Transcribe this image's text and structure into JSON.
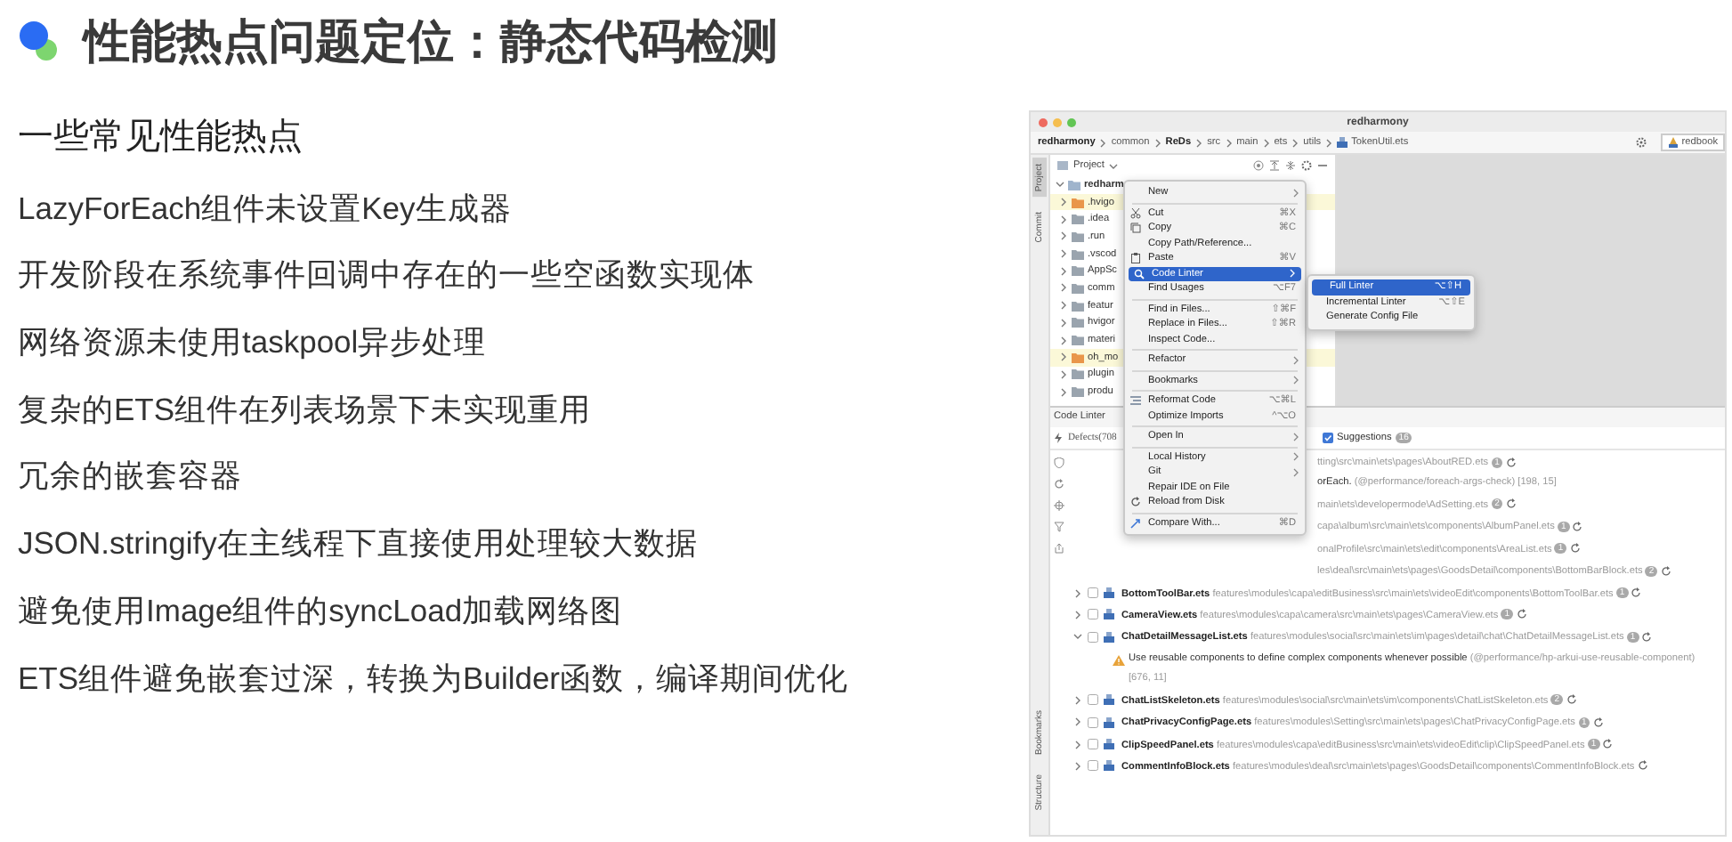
{
  "slide": {
    "title": "性能热点问题定位：静态代码检测",
    "subtitle": "一些常见性能热点",
    "points": [
      "LazyForEach组件未设置Key生成器",
      "开发阶段在系统事件回调中存在的一些空函数实现体",
      "网络资源未使用taskpool异步处理",
      "复杂的ETS组件在列表场景下未实现重用",
      "冗余的嵌套容器",
      "JSON.stringify在主线程下直接使用处理较大数据",
      "避免使用Image组件的syncLoad加载网络图",
      "ETS组件避免嵌套过深，转换为Builder函数，编译期间优化"
    ]
  },
  "ide": {
    "window_title": "redharmony",
    "breadcrumb": [
      {
        "label": "redharmony",
        "bold": true,
        "kind": "folder"
      },
      {
        "label": "common",
        "bold": false,
        "kind": "folder"
      },
      {
        "label": "ReDs",
        "bold": true,
        "kind": "folder"
      },
      {
        "label": "src",
        "bold": false,
        "kind": "folder"
      },
      {
        "label": "main",
        "bold": false,
        "kind": "folder"
      },
      {
        "label": "ets",
        "bold": false,
        "kind": "folder"
      },
      {
        "label": "utils",
        "bold": false,
        "kind": "folder"
      },
      {
        "label": "TokenUtil.ets",
        "bold": false,
        "kind": "file"
      }
    ],
    "run_config": "redbook",
    "tool_stripe": {
      "top": [
        {
          "label": "Project",
          "selected": true
        },
        {
          "label": "Commit",
          "selected": false
        }
      ],
      "bottom": [
        {
          "label": "Bookmarks",
          "selected": false
        },
        {
          "label": "Structure",
          "selected": false
        }
      ]
    },
    "project": {
      "title": "Project",
      "tree": [
        {
          "label": "redharm",
          "kind": "module",
          "expanded": true,
          "children": [
            {
              "label": ".hvigo",
              "kind": "excluded",
              "expanded": false
            },
            {
              "label": ".idea",
              "kind": "folder",
              "expanded": false
            },
            {
              "label": ".run",
              "kind": "folder",
              "expanded": false
            },
            {
              "label": ".vscod",
              "kind": "folder",
              "expanded": false
            },
            {
              "label": "AppSc",
              "kind": "folder",
              "expanded": false
            },
            {
              "label": "comm",
              "kind": "folder",
              "expanded": false
            },
            {
              "label": "featur",
              "kind": "folder",
              "expanded": false
            },
            {
              "label": "hvigor",
              "kind": "folder",
              "expanded": false
            },
            {
              "label": "materi",
              "kind": "folder",
              "expanded": false
            },
            {
              "label": "oh_mo",
              "kind": "excluded",
              "expanded": false
            },
            {
              "label": "plugin",
              "kind": "folder",
              "expanded": false
            },
            {
              "label": "produ",
              "kind": "folder",
              "expanded": false
            }
          ]
        }
      ]
    },
    "linter": {
      "title": "Code Linter",
      "defects": "Defects(708",
      "suggestions": {
        "label": "Suggestions",
        "count": "16",
        "checked": true
      },
      "rows": [
        {
          "kind": "covered-file",
          "path": "tting\\src\\main\\ets\\pages\\AboutRED.ets",
          "count": "1"
        },
        {
          "kind": "covered-issue",
          "message": "orEach.",
          "rule": "(@performance/foreach-args-check) [198, 15]"
        },
        {
          "kind": "covered-file",
          "path": "main\\ets\\developermode\\AdSetting.ets",
          "count": "2"
        },
        {
          "kind": "covered-file",
          "path": "capa\\album\\src\\main\\ets\\components\\AlbumPanel.ets",
          "count": "1"
        },
        {
          "kind": "covered-file",
          "path": "onalProfile\\src\\main\\ets\\edit\\components\\AreaList.ets",
          "count": "1"
        },
        {
          "kind": "covered-file",
          "path": "les\\deal\\src\\main\\ets\\pages\\GoodsDetail\\components\\BottomBarBlock.ets",
          "count": "2"
        },
        {
          "kind": "file",
          "expanded": false,
          "checked": false,
          "name": "BottomToolBar.ets",
          "path": "features\\modules\\capa\\editBusiness\\src\\main\\ets\\videoEdit\\components\\BottomToolBar.ets",
          "count": "1"
        },
        {
          "kind": "file",
          "expanded": false,
          "checked": false,
          "name": "CameraView.ets",
          "path": "features\\modules\\capa\\camera\\src\\main\\ets\\pages\\CameraView.ets",
          "count": "1"
        },
        {
          "kind": "file",
          "expanded": true,
          "checked": false,
          "name": "ChatDetailMessageList.ets",
          "path": "features\\modules\\social\\src\\main\\ets\\im\\pages\\detail\\chat\\ChatDetailMessageList.ets",
          "count": "1"
        },
        {
          "kind": "issue",
          "message": "Use reusable components to define complex components whenever possible",
          "rule": "(@performance/hp-arkui-use-reusable-component) [676, 11]"
        },
        {
          "kind": "file",
          "expanded": false,
          "checked": false,
          "name": "ChatListSkeleton.ets",
          "path": "features\\modules\\social\\src\\main\\ets\\im\\components\\ChatListSkeleton.ets",
          "count": "2"
        },
        {
          "kind": "file",
          "expanded": false,
          "checked": false,
          "name": "ChatPrivacyConfigPage.ets",
          "path": "features\\modules\\Setting\\src\\main\\ets\\pages\\ChatPrivacyConfigPage.ets",
          "count": "1"
        },
        {
          "kind": "file",
          "expanded": false,
          "checked": false,
          "name": "ClipSpeedPanel.ets",
          "path": "features\\modules\\capa\\editBusiness\\src\\main\\ets\\videoEdit\\clip\\ClipSpeedPanel.ets",
          "count": "1"
        },
        {
          "kind": "file",
          "expanded": false,
          "checked": false,
          "name": "CommentInfoBlock.ets",
          "path": "features\\modules\\deal\\src\\main\\ets\\pages\\GoodsDetail\\components\\CommentInfoBlock.ets"
        }
      ]
    },
    "menu": {
      "items": [
        {
          "kind": "plain",
          "label": "New",
          "submenu": true,
          "selected": false
        },
        {
          "kind": "separator"
        },
        {
          "kind": "cut",
          "label": "Cut",
          "shortcut": "⌘X",
          "submenu": false,
          "selected": false
        },
        {
          "kind": "copy",
          "label": "Copy",
          "shortcut": "⌘C",
          "submenu": false,
          "selected": false
        },
        {
          "kind": "plain",
          "label": "Copy Path/Reference...",
          "submenu": false,
          "selected": false
        },
        {
          "kind": "paste",
          "label": "Paste",
          "shortcut": "⌘V",
          "submenu": false,
          "selected": false
        },
        {
          "kind": "linter",
          "label": "Code Linter",
          "submenu": true,
          "selected": true
        },
        {
          "kind": "plain",
          "label": "Find Usages",
          "shortcut": "⌥F7",
          "submenu": false,
          "selected": false
        },
        {
          "kind": "separator"
        },
        {
          "kind": "plain",
          "label": "Find in Files...",
          "shortcut": "⇧⌘F",
          "submenu": false,
          "selected": false
        },
        {
          "kind": "plain",
          "label": "Replace in Files...",
          "shortcut": "⇧⌘R",
          "submenu": false,
          "selected": false
        },
        {
          "kind": "plain",
          "label": "Inspect Code...",
          "submenu": false,
          "selected": false
        },
        {
          "kind": "separator"
        },
        {
          "kind": "plain",
          "label": "Refactor",
          "submenu": true,
          "selected": false
        },
        {
          "kind": "separator"
        },
        {
          "kind": "plain",
          "label": "Bookmarks",
          "submenu": true,
          "selected": false
        },
        {
          "kind": "separator"
        },
        {
          "kind": "reformat",
          "label": "Reformat Code",
          "shortcut": "⌥⌘L",
          "submenu": false,
          "selected": false
        },
        {
          "kind": "plain",
          "label": "Optimize Imports",
          "shortcut": "^⌥O",
          "submenu": false,
          "selected": false
        },
        {
          "kind": "separator"
        },
        {
          "kind": "plain",
          "label": "Open In",
          "submenu": true,
          "selected": false
        },
        {
          "kind": "separator"
        },
        {
          "kind": "plain",
          "label": "Local History",
          "submenu": true,
          "selected": false
        },
        {
          "kind": "plain",
          "label": "Git",
          "submenu": true,
          "selected": false
        },
        {
          "kind": "plain",
          "label": "Repair IDE on File",
          "submenu": false,
          "selected": false
        },
        {
          "kind": "reload",
          "label": "Reload from Disk",
          "submenu": false,
          "selected": false
        },
        {
          "kind": "separator"
        },
        {
          "kind": "compare",
          "label": "Compare With...",
          "shortcut": "⌘D",
          "submenu": false,
          "selected": false
        }
      ]
    },
    "submenu": {
      "items": [
        {
          "label": "Full Linter",
          "shortcut": "⌥⇧H",
          "selected": true
        },
        {
          "label": "Incremental Linter",
          "shortcut": "⌥⇧E",
          "selected": false
        },
        {
          "label": "Generate Config File",
          "selected": false
        }
      ]
    }
  }
}
